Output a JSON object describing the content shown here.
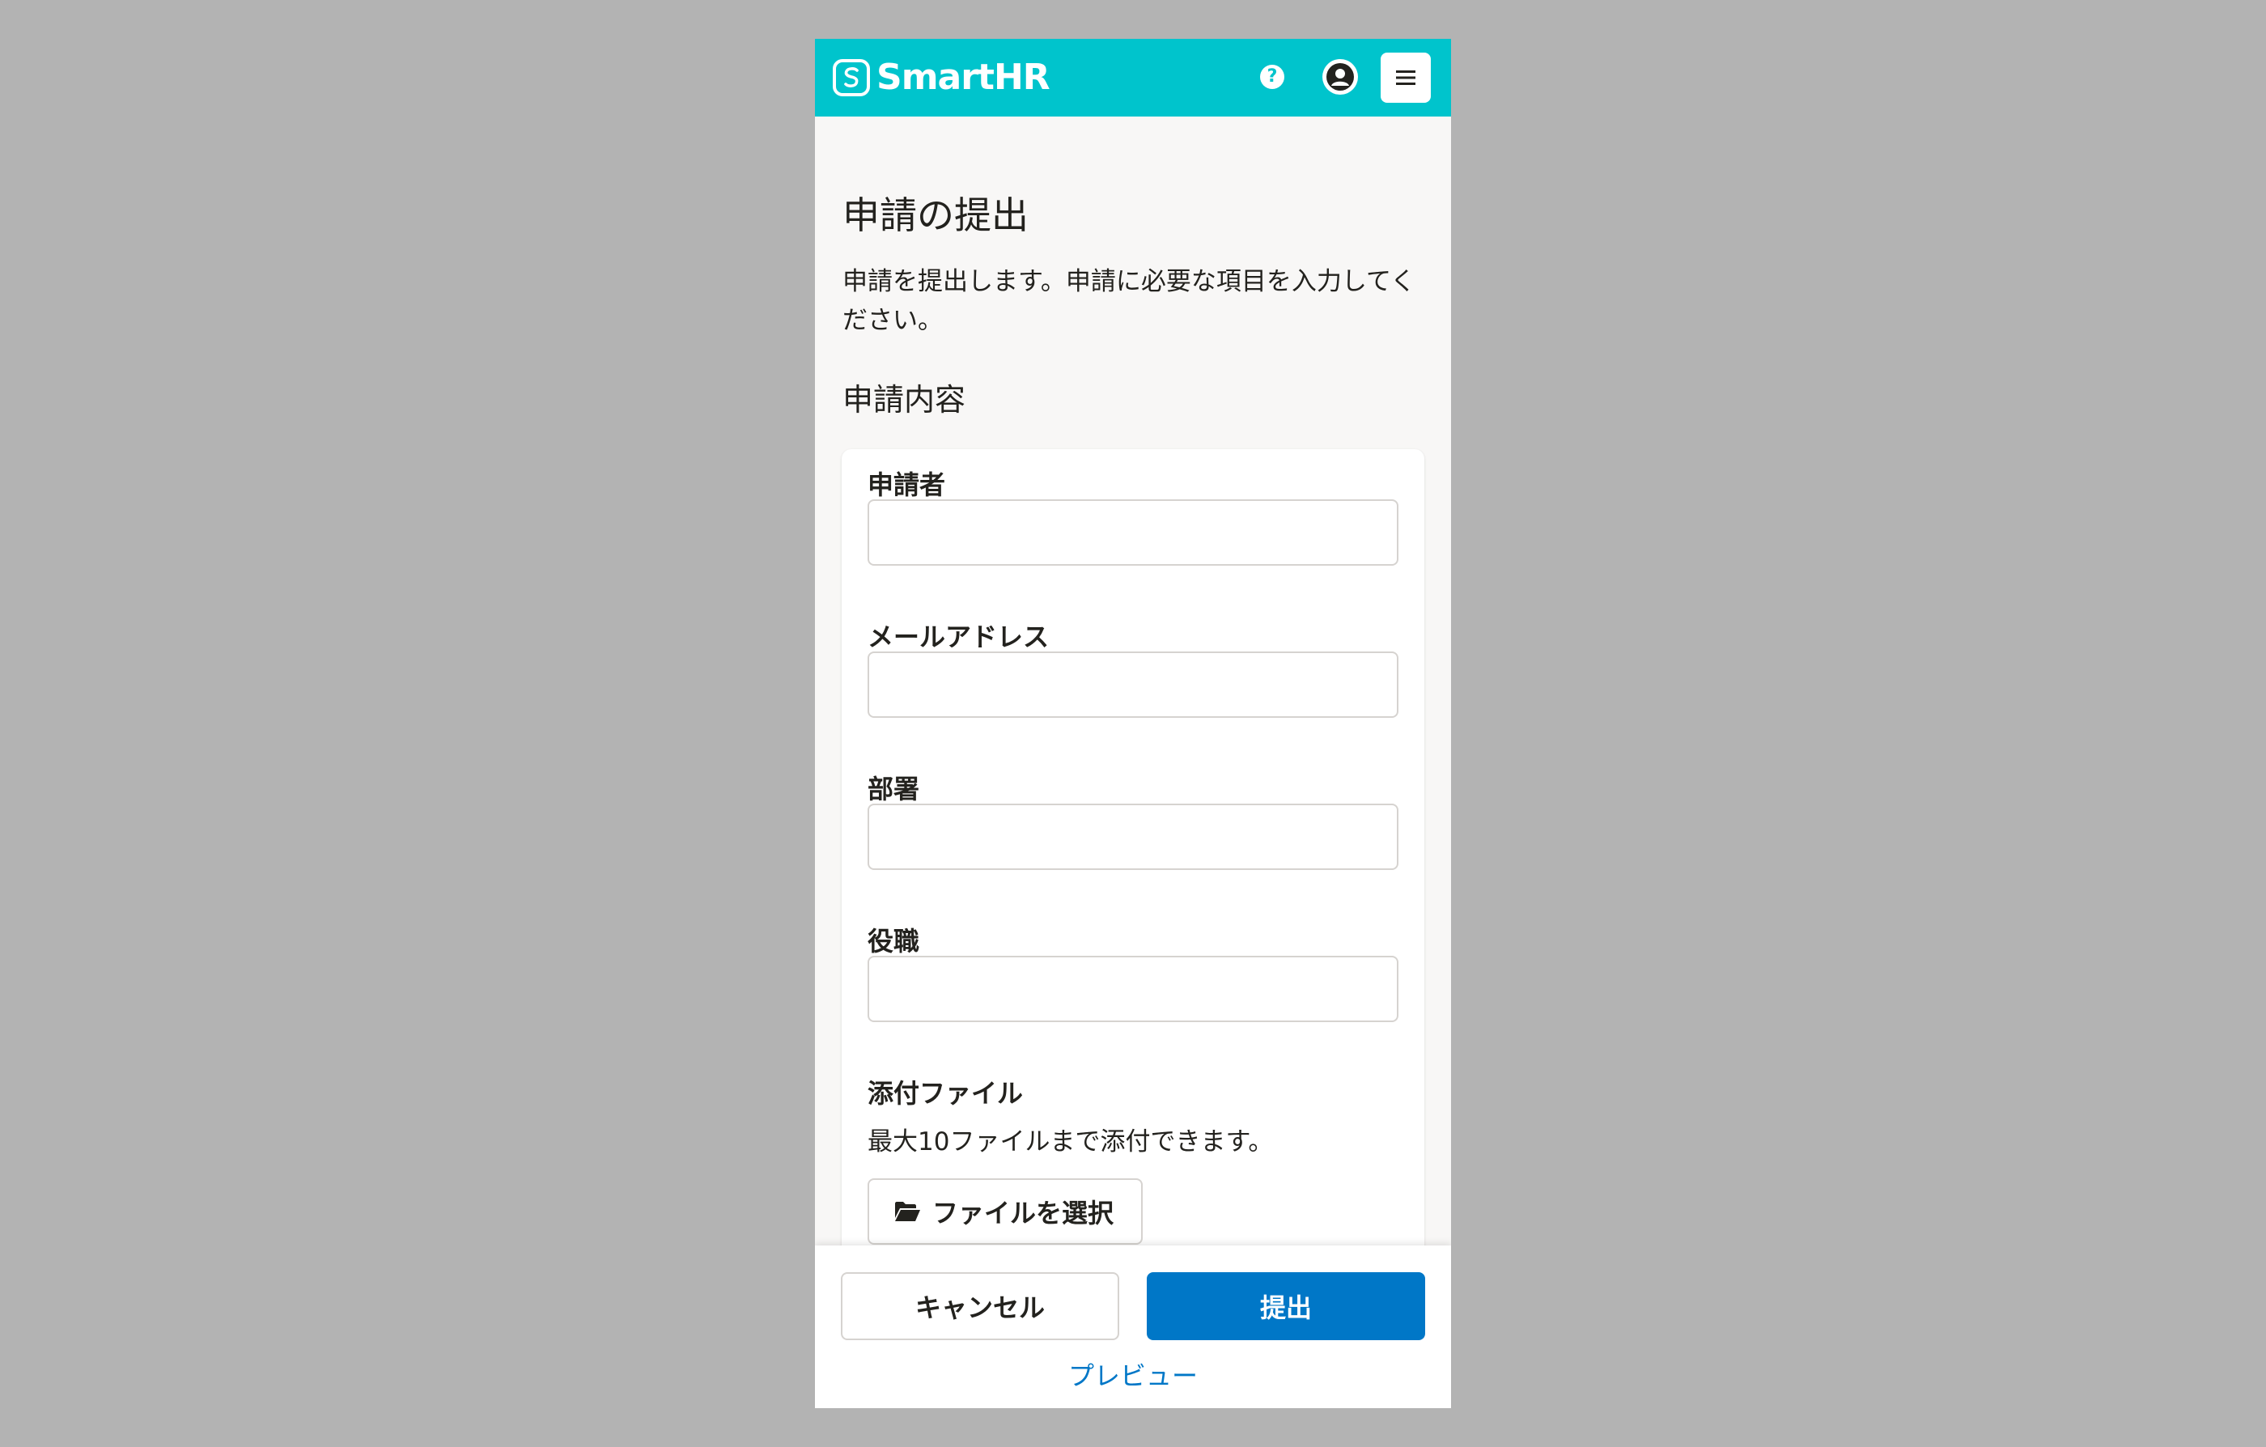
{
  "header": {
    "logo_text": "SmartHR",
    "help_glyph": "?",
    "icons": [
      "smarthr-logo-icon",
      "help-icon",
      "account-icon",
      "hamburger-menu-icon"
    ]
  },
  "page": {
    "title": "申請の提出",
    "description": "申請を提出します。申請に必要な項目を入力してください。",
    "section_title": "申請内容"
  },
  "form": {
    "fields": [
      {
        "label": "申請者",
        "value": "",
        "placeholder": ""
      },
      {
        "label": "メールアドレス",
        "value": "",
        "placeholder": ""
      },
      {
        "label": "部署",
        "value": "",
        "placeholder": ""
      },
      {
        "label": "役職",
        "value": "",
        "placeholder": ""
      }
    ],
    "attachment": {
      "label": "添付ファイル",
      "help_text": "最大10ファイルまで添付できます。",
      "select_button_label": "ファイルを選択",
      "icon": "folder-open-icon"
    }
  },
  "footer": {
    "cancel_label": "キャンセル",
    "submit_label": "提出",
    "preview_label": "プレビュー"
  },
  "colors": {
    "header_bg": "#00c4cc",
    "primary": "#0077c7",
    "page_bg": "#f8f7f6",
    "outer_bg": "#b3b3b3"
  }
}
